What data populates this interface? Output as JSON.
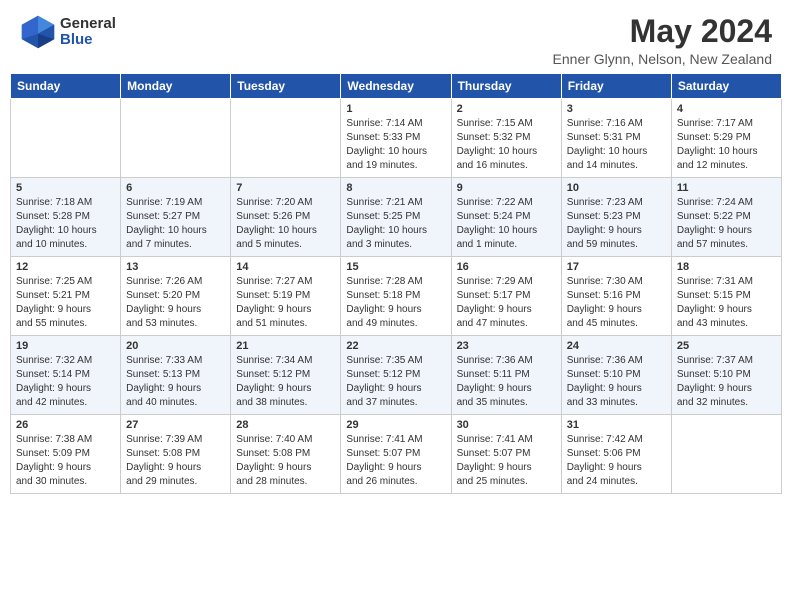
{
  "logo": {
    "general": "General",
    "blue": "Blue"
  },
  "header": {
    "month": "May 2024",
    "location": "Enner Glynn, Nelson, New Zealand"
  },
  "days_of_week": [
    "Sunday",
    "Monday",
    "Tuesday",
    "Wednesday",
    "Thursday",
    "Friday",
    "Saturday"
  ],
  "weeks": [
    [
      {
        "day": "",
        "info": ""
      },
      {
        "day": "",
        "info": ""
      },
      {
        "day": "",
        "info": ""
      },
      {
        "day": "1",
        "info": "Sunrise: 7:14 AM\nSunset: 5:33 PM\nDaylight: 10 hours\nand 19 minutes."
      },
      {
        "day": "2",
        "info": "Sunrise: 7:15 AM\nSunset: 5:32 PM\nDaylight: 10 hours\nand 16 minutes."
      },
      {
        "day": "3",
        "info": "Sunrise: 7:16 AM\nSunset: 5:31 PM\nDaylight: 10 hours\nand 14 minutes."
      },
      {
        "day": "4",
        "info": "Sunrise: 7:17 AM\nSunset: 5:29 PM\nDaylight: 10 hours\nand 12 minutes."
      }
    ],
    [
      {
        "day": "5",
        "info": "Sunrise: 7:18 AM\nSunset: 5:28 PM\nDaylight: 10 hours\nand 10 minutes."
      },
      {
        "day": "6",
        "info": "Sunrise: 7:19 AM\nSunset: 5:27 PM\nDaylight: 10 hours\nand 7 minutes."
      },
      {
        "day": "7",
        "info": "Sunrise: 7:20 AM\nSunset: 5:26 PM\nDaylight: 10 hours\nand 5 minutes."
      },
      {
        "day": "8",
        "info": "Sunrise: 7:21 AM\nSunset: 5:25 PM\nDaylight: 10 hours\nand 3 minutes."
      },
      {
        "day": "9",
        "info": "Sunrise: 7:22 AM\nSunset: 5:24 PM\nDaylight: 10 hours\nand 1 minute."
      },
      {
        "day": "10",
        "info": "Sunrise: 7:23 AM\nSunset: 5:23 PM\nDaylight: 9 hours\nand 59 minutes."
      },
      {
        "day": "11",
        "info": "Sunrise: 7:24 AM\nSunset: 5:22 PM\nDaylight: 9 hours\nand 57 minutes."
      }
    ],
    [
      {
        "day": "12",
        "info": "Sunrise: 7:25 AM\nSunset: 5:21 PM\nDaylight: 9 hours\nand 55 minutes."
      },
      {
        "day": "13",
        "info": "Sunrise: 7:26 AM\nSunset: 5:20 PM\nDaylight: 9 hours\nand 53 minutes."
      },
      {
        "day": "14",
        "info": "Sunrise: 7:27 AM\nSunset: 5:19 PM\nDaylight: 9 hours\nand 51 minutes."
      },
      {
        "day": "15",
        "info": "Sunrise: 7:28 AM\nSunset: 5:18 PM\nDaylight: 9 hours\nand 49 minutes."
      },
      {
        "day": "16",
        "info": "Sunrise: 7:29 AM\nSunset: 5:17 PM\nDaylight: 9 hours\nand 47 minutes."
      },
      {
        "day": "17",
        "info": "Sunrise: 7:30 AM\nSunset: 5:16 PM\nDaylight: 9 hours\nand 45 minutes."
      },
      {
        "day": "18",
        "info": "Sunrise: 7:31 AM\nSunset: 5:15 PM\nDaylight: 9 hours\nand 43 minutes."
      }
    ],
    [
      {
        "day": "19",
        "info": "Sunrise: 7:32 AM\nSunset: 5:14 PM\nDaylight: 9 hours\nand 42 minutes."
      },
      {
        "day": "20",
        "info": "Sunrise: 7:33 AM\nSunset: 5:13 PM\nDaylight: 9 hours\nand 40 minutes."
      },
      {
        "day": "21",
        "info": "Sunrise: 7:34 AM\nSunset: 5:12 PM\nDaylight: 9 hours\nand 38 minutes."
      },
      {
        "day": "22",
        "info": "Sunrise: 7:35 AM\nSunset: 5:12 PM\nDaylight: 9 hours\nand 37 minutes."
      },
      {
        "day": "23",
        "info": "Sunrise: 7:36 AM\nSunset: 5:11 PM\nDaylight: 9 hours\nand 35 minutes."
      },
      {
        "day": "24",
        "info": "Sunrise: 7:36 AM\nSunset: 5:10 PM\nDaylight: 9 hours\nand 33 minutes."
      },
      {
        "day": "25",
        "info": "Sunrise: 7:37 AM\nSunset: 5:10 PM\nDaylight: 9 hours\nand 32 minutes."
      }
    ],
    [
      {
        "day": "26",
        "info": "Sunrise: 7:38 AM\nSunset: 5:09 PM\nDaylight: 9 hours\nand 30 minutes."
      },
      {
        "day": "27",
        "info": "Sunrise: 7:39 AM\nSunset: 5:08 PM\nDaylight: 9 hours\nand 29 minutes."
      },
      {
        "day": "28",
        "info": "Sunrise: 7:40 AM\nSunset: 5:08 PM\nDaylight: 9 hours\nand 28 minutes."
      },
      {
        "day": "29",
        "info": "Sunrise: 7:41 AM\nSunset: 5:07 PM\nDaylight: 9 hours\nand 26 minutes."
      },
      {
        "day": "30",
        "info": "Sunrise: 7:41 AM\nSunset: 5:07 PM\nDaylight: 9 hours\nand 25 minutes."
      },
      {
        "day": "31",
        "info": "Sunrise: 7:42 AM\nSunset: 5:06 PM\nDaylight: 9 hours\nand 24 minutes."
      },
      {
        "day": "",
        "info": ""
      }
    ]
  ]
}
